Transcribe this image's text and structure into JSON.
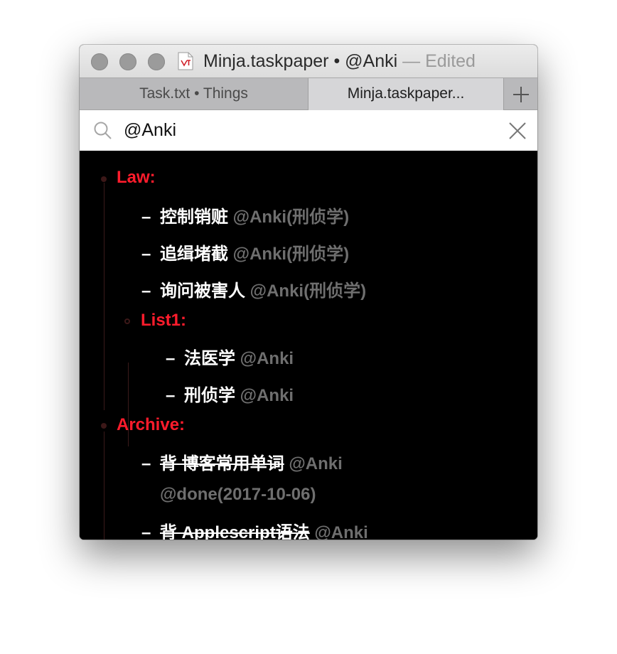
{
  "window": {
    "title_file": "Minja.taskpaper",
    "title_bullet": "•",
    "title_filter": "@Anki",
    "title_sep": "—",
    "title_status": "Edited"
  },
  "tabs": [
    {
      "label": "Task.txt • Things"
    },
    {
      "label": "Minja.taskpaper..."
    }
  ],
  "search": {
    "query": "@Anki"
  },
  "outline": {
    "project1": {
      "label": "Law:"
    },
    "project1_tasks": [
      {
        "dash": "–",
        "text": "控制销赃",
        "tag": "@Anki(刑侦学)"
      },
      {
        "dash": "–",
        "text": "追缉堵截",
        "tag": "@Anki(刑侦学)"
      },
      {
        "dash": "–",
        "text": "询问被害人",
        "tag": "@Anki(刑侦学)"
      }
    ],
    "project2": {
      "label": "List1:"
    },
    "project2_tasks": [
      {
        "dash": "–",
        "text": "法医学",
        "tag": "@Anki"
      },
      {
        "dash": "–",
        "text": "刑侦学",
        "tag": "@Anki"
      }
    ],
    "project3": {
      "label": "Archive:"
    },
    "project3_tasks": [
      {
        "dash": "–",
        "text": "背 博客常用单词",
        "tag": "@Anki",
        "tag2": "@done(2017-10-06)"
      },
      {
        "dash": "–",
        "text": "背 Applescript语法",
        "tag": "@Anki"
      }
    ]
  },
  "colors": {
    "project": "#ff1c2c",
    "tag": "#6f6f6f",
    "task": "#ffffff",
    "background": "#000000"
  }
}
